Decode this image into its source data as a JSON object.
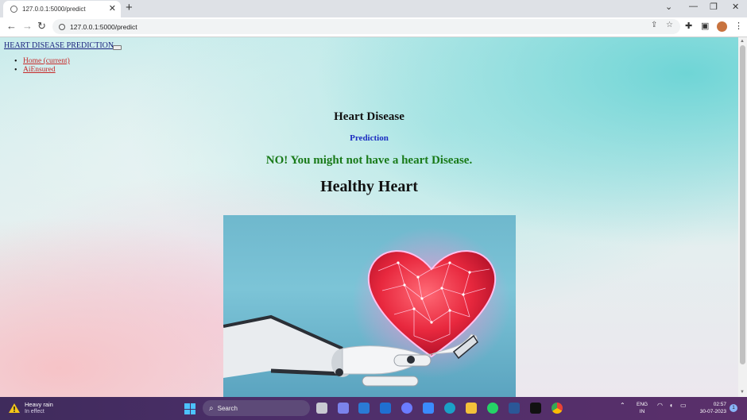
{
  "browser": {
    "tab_title": "127.0.0.1:5000/predict",
    "url": "127.0.0.1:5000/predict"
  },
  "page": {
    "brand": "HEART DISEASE PREDICTION",
    "nav": [
      "Home (current)",
      "AiEnsured"
    ],
    "title": "Heart Disease",
    "subtitle": "Prediction",
    "result": "NO! You might not have a heart Disease.",
    "verdict": "Healthy Heart"
  },
  "taskbar": {
    "weather_title": "Heavy rain",
    "weather_status": "In effect",
    "search_placeholder": "Search",
    "lang_line1": "ENG",
    "lang_line2": "IN",
    "time": "02:57",
    "date": "30-07-2023",
    "notification_count": "1"
  },
  "colors": {
    "result_green": "#197a19",
    "subtitle_blue": "#1b2cc1",
    "nav_link_red": "#c62828",
    "taskbar_purple": "#4e2f6b"
  }
}
